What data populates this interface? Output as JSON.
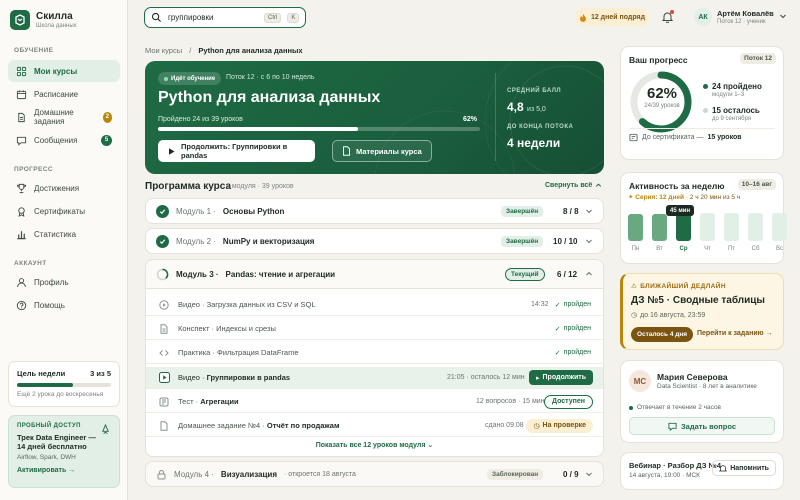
{
  "brand": {
    "name": "Скилла",
    "sub": "Школа данных"
  },
  "nav": {
    "learning_title": "ОБУЧЕНИЕ",
    "my_courses": "Мои курсы",
    "schedule": "Расписание",
    "homework": "Домашние задания",
    "homework_count": "2",
    "messages": "Сообщения",
    "messages_count": "5",
    "progress_title": "ПРОГРЕСС",
    "achievements": "Достижения",
    "certificates": "Сертификаты",
    "statistics": "Статистика",
    "account_title": "АККАУНТ",
    "profile": "Профиль",
    "help": "Помощь"
  },
  "goal": {
    "title": "Цель недели",
    "value": "3 из 5",
    "progress": 0.6,
    "sub": "Ещё 2 урока до воскресенья"
  },
  "trial": {
    "tag": "ПРОБНЫЙ ДОСТУП",
    "title": "Трек Data Engineer — 14 дней бесплатно",
    "sub": "Airflow, Spark, DWH",
    "link": "Активировать →"
  },
  "search": {
    "value": "группировки",
    "kbd1": "Ctrl",
    "kbd2": "K"
  },
  "streak": "12 дней подряд",
  "user": {
    "initials": "АК",
    "name": "Артём Ковалёв",
    "role": "Поток 12 · ученик"
  },
  "breadcrumb": {
    "root": "Мои курсы",
    "sep": "/",
    "current": "Python для анализа данных"
  },
  "hero": {
    "pill": "Идёт обучение",
    "meta": "Поток 12 · с 6 по 10 недель",
    "title": "Python для анализа данных",
    "progress_text": "Пройдено 24 из 39 уроков",
    "progress_pct": "62%",
    "progress": 0.62,
    "continue": "Продолжить: Группировки в pandas",
    "materials": "Материалы курса",
    "avg_label": "СРЕДНИЙ БАЛЛ",
    "avg_value": "4,8",
    "avg_of": "из 5,0",
    "end_label": "ДО КОНЦА ПОТОКА",
    "end_value": "4 недели"
  },
  "program": {
    "title": "Программа курса",
    "meta": "4 модуля · 39 уроков",
    "collapse": "Свернуть всё"
  },
  "modules": [
    {
      "num": "Модуль 1 ·",
      "name": "Основы Python",
      "badge": "Завершён",
      "score": "8 / 8"
    },
    {
      "num": "Модуль 2 ·",
      "name": "NumPy и векторизация",
      "badge": "Завершён",
      "score": "10 / 10"
    },
    {
      "num": "Модуль 3 ·",
      "name": "Pandas: чтение и агрегации",
      "badge": "Текущий",
      "score": "6 / 12"
    },
    {
      "num": "Модуль 4 ·",
      "name": "Визуализация",
      "extra": "· откроется 18 августа",
      "badge": "Заблокирован",
      "score": "0 / 9"
    }
  ],
  "lessons": [
    {
      "type": "Видео ·",
      "name": "Загрузка данных из CSV и SQL",
      "right": "14:32",
      "status": "пройден"
    },
    {
      "type": "Конспект ·",
      "name": "Индексы и срезы",
      "right": "",
      "status": "пройден"
    },
    {
      "type": "Практика ·",
      "name": "Фильтрация DataFrame",
      "right": "",
      "status": "пройден"
    },
    {
      "type": "Видео ·",
      "name": "Группировки в pandas",
      "right": "21:05 · осталось 12 мин",
      "action": "Продолжить"
    },
    {
      "type": "Тест ·",
      "name": "Агрегации",
      "right": "12 вопросов · 15 мин",
      "action": "Доступен"
    },
    {
      "type": "Домашнее задание №4 ·",
      "name": "Отчёт по продажам",
      "right": "сдано 09.08",
      "action": "На проверке"
    }
  ],
  "show_all": "Показать все 12 уроков модуля",
  "progress_card": {
    "title": "Ваш прогресс",
    "tag": "Поток 12",
    "pct": "62%",
    "sub": "24/39 уроков",
    "progress": 0.62,
    "done": "24 пройдено",
    "done_sub": "модули 1–3",
    "left": "15 осталось",
    "left_sub": "до 9 сентября",
    "cert_pre": "До сертификата —",
    "cert_val": "15 уроков"
  },
  "activity": {
    "title": "Активность за неделю",
    "range": "10–16 авг",
    "streak_pre": "Серия: 12 дней",
    "streak_post": "· 2 ч 20 мин из 5 ч",
    "tooltip": "45 мин",
    "days": [
      {
        "label": "Пн",
        "level": 0.45,
        "state": "done"
      },
      {
        "label": "Вт",
        "level": 0.45,
        "state": "done"
      },
      {
        "label": "Ср",
        "level": 0.45,
        "state": "today"
      },
      {
        "label": "Чт",
        "level": 0,
        "state": "empty"
      },
      {
        "label": "Пт",
        "level": 0,
        "state": "empty"
      },
      {
        "label": "Сб",
        "level": 0,
        "state": "empty"
      },
      {
        "label": "Вс",
        "level": 0,
        "state": "empty"
      }
    ],
    "colors": {
      "done": "#6aa882",
      "today": "#1f6b45",
      "empty": "#e2efe6"
    }
  },
  "deadline": {
    "tag": "БЛИЖАЙШИЙ ДЕДЛАЙН",
    "title": "ДЗ №5 · Сводные таблицы",
    "date": "до 16 августа, 23:59",
    "left": "Осталось 4 дня",
    "go": "Перейти к заданию →"
  },
  "mentor": {
    "initials": "МС",
    "name": "Мария Северова",
    "role": "Data Scientist · 8 лет в аналитике",
    "resp": "Отвечает в течение 2 часов",
    "ask": "Задать вопрос"
  },
  "webinar": {
    "title": "Вебинар · Разбор ДЗ №4",
    "sub": "14 августа, 19:00 · МСК",
    "remind": "Напомнить"
  }
}
